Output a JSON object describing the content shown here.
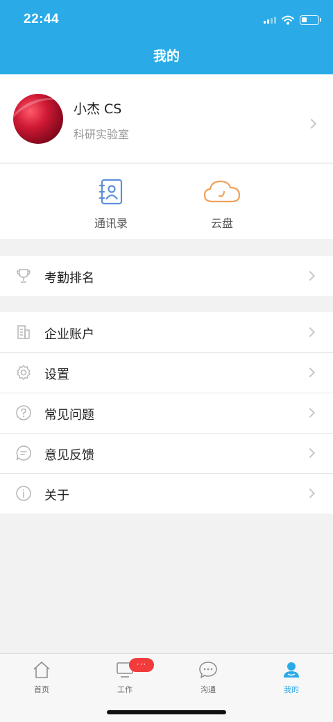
{
  "status_bar": {
    "time": "22:44"
  },
  "header": {
    "title": "我的"
  },
  "profile": {
    "name": "小杰   CS",
    "organization": "科研实验室"
  },
  "shortcuts": [
    {
      "label": "通讯录",
      "icon": "contacts-book-icon",
      "color": "#5b8fdc"
    },
    {
      "label": "云盘",
      "icon": "cloud-icon",
      "color": "#f0a15a"
    }
  ],
  "menu_groups": [
    {
      "items": [
        {
          "label": "考勤排名",
          "icon": "trophy-icon"
        }
      ]
    },
    {
      "items": [
        {
          "label": "企业账户",
          "icon": "building-icon"
        },
        {
          "label": "设置",
          "icon": "gear-icon"
        },
        {
          "label": "常见问题",
          "icon": "question-icon"
        },
        {
          "label": "意见反馈",
          "icon": "feedback-icon"
        },
        {
          "label": "关于",
          "icon": "info-icon"
        }
      ]
    }
  ],
  "tabbar": {
    "items": [
      {
        "label": "首页",
        "icon": "home-icon",
        "active": false
      },
      {
        "label": "工作",
        "icon": "monitor-icon",
        "active": false,
        "badge": "···"
      },
      {
        "label": "沟通",
        "icon": "chat-icon",
        "active": false
      },
      {
        "label": "我的",
        "icon": "person-icon",
        "active": true
      }
    ]
  },
  "colors": {
    "accent": "#2aabe8",
    "badge": "#f23b3b",
    "background": "#f2f2f2"
  }
}
